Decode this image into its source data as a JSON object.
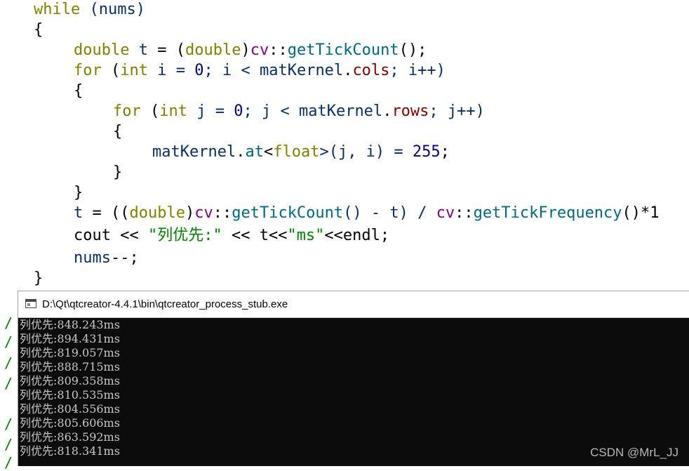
{
  "editor": {
    "code": {
      "while_kw": "while",
      "while_cond": " (nums)",
      "open_brace_outer": "{",
      "double_kw": "double",
      "t_var": "t",
      "assign": " = (",
      "double_cast": "double",
      "cast_close": ")",
      "cv_ns": "cv",
      "scope_op": "::",
      "getTickCount_fn": "getTickCount",
      "call_end": "();",
      "for_kw": "for",
      "for_open": " (",
      "int_kw": "int",
      "i_decl": " i = ",
      "zero": "0",
      "i_cmp": "; i < ",
      "matKernel": "matKernel",
      "dot": ".",
      "cols_mem": "cols",
      "i_inc": "; i++)",
      "open_brace_1": "{",
      "j_decl": " j = ",
      "j_cmp": "; j < ",
      "rows_mem": "rows",
      "j_inc": "; j++)",
      "open_brace_2": "{",
      "at_fn": "at",
      "lt": "<",
      "float_kw": "float",
      "gt_args": ">(j, i) = ",
      "value_255": "255",
      "semicolon": ";",
      "close_brace_2": "}",
      "close_brace_1": "}",
      "t_assign": " = ((",
      "minus_t": "() - t) / ",
      "getTickFrequency_fn": "getTickFrequency",
      "tail": "()*1",
      "cout_start": "cout << ",
      "col_first_str": "\"列优先:\"",
      "cout_mid": " << t<<",
      "ms_str": "\"ms\"",
      "cout_end": "<<endl;",
      "nums_dec": "nums",
      "dec_op": "--;",
      "close_brace_outer": "}"
    },
    "gutter_marks": [
      "/",
      "/",
      "/",
      "/",
      "/",
      "/",
      "/"
    ]
  },
  "console": {
    "title": "D:\\Qt\\qtcreator-4.4.1\\bin\\qtcreator_process_stub.exe",
    "icon": "console-window-icon",
    "lines": [
      "列优先:848.243ms",
      "列优先:894.431ms",
      "列优先:819.057ms",
      "列优先:888.715ms",
      "列优先:809.358ms",
      "列优先:810.535ms",
      "列优先:804.556ms",
      "列优先:805.606ms",
      "列优先:863.592ms",
      "列优先:818.341ms"
    ]
  },
  "watermark": "CSDN @MrL_JJ",
  "colors": {
    "keyword": "#808000",
    "namespace": "#800080",
    "function": "#00677c",
    "number": "#000080",
    "string": "#008000",
    "member": "#800000",
    "console_bg": "#0c0c0c",
    "console_text": "#c8c8c8"
  }
}
